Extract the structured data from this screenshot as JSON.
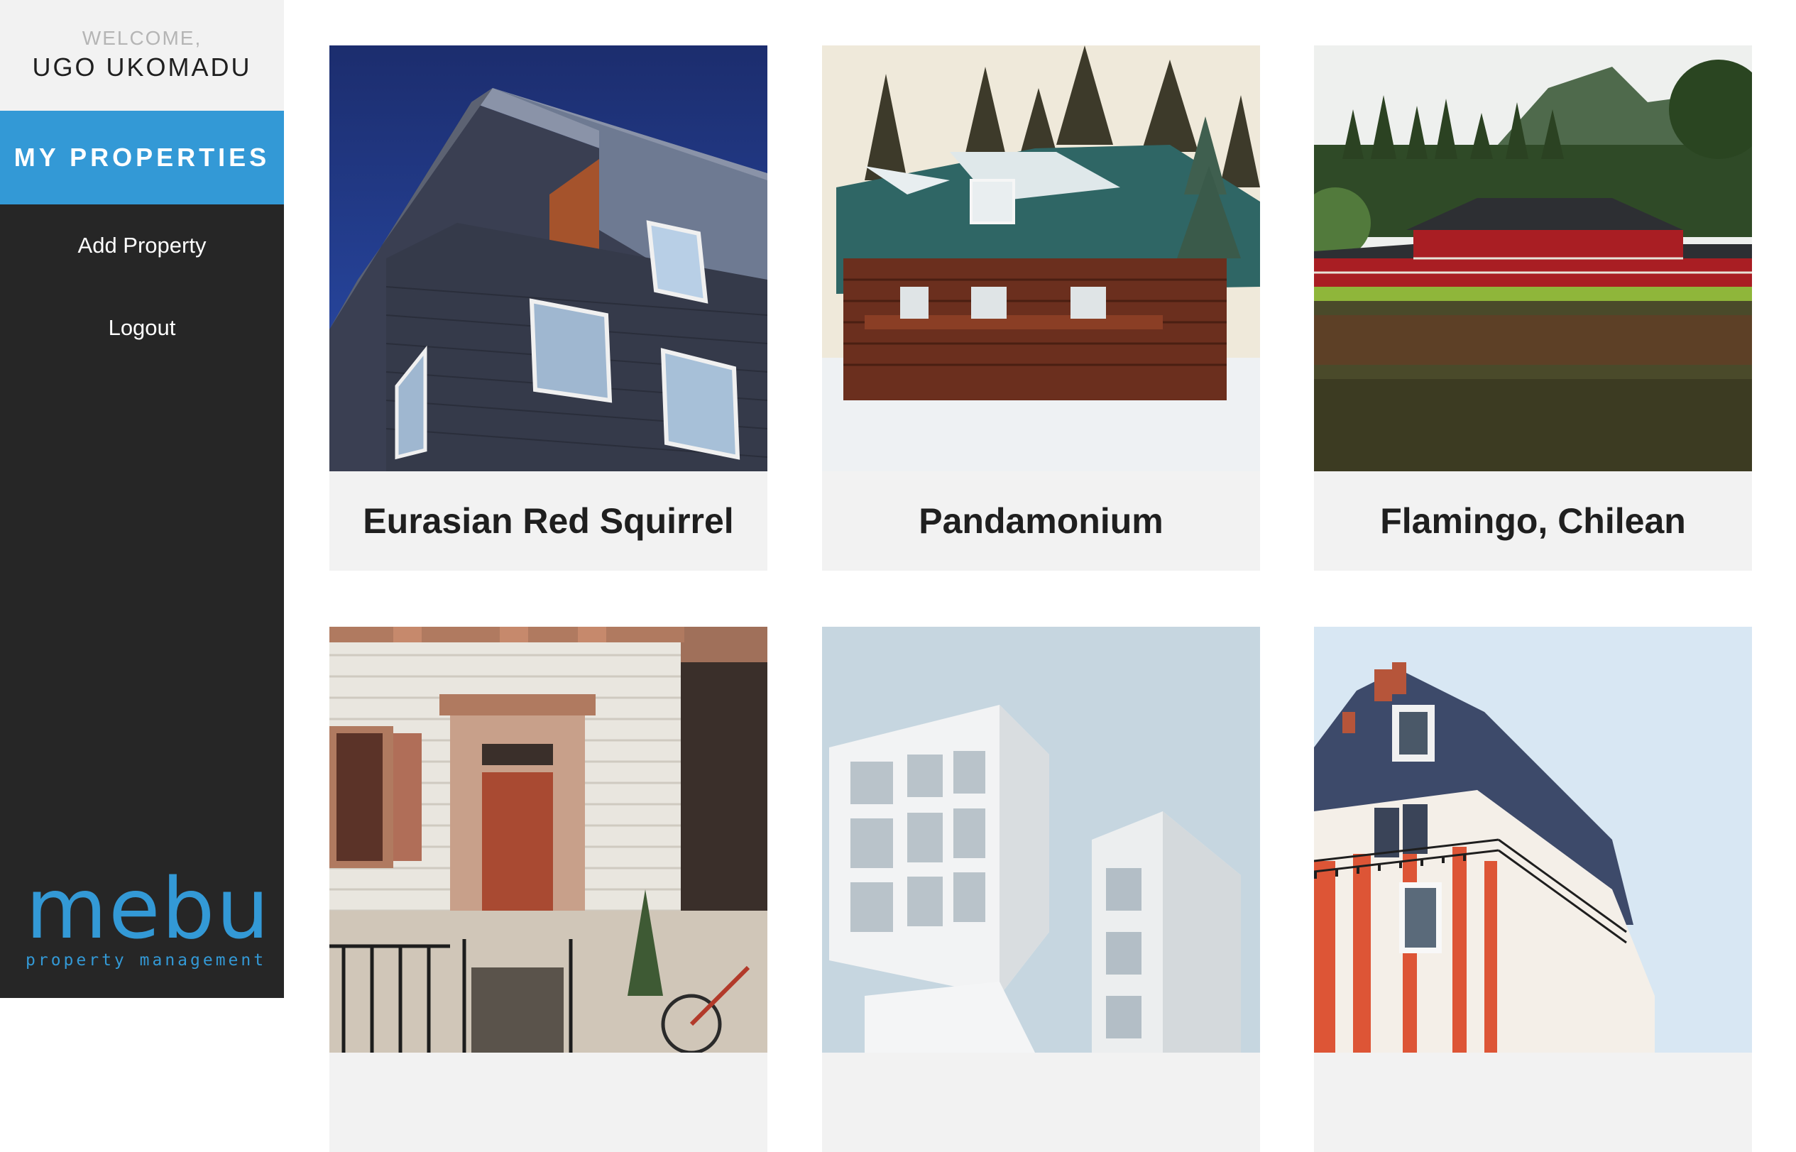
{
  "sidebar": {
    "welcome_label": "WELCOME,",
    "user_name": "UGO UKOMADU",
    "nav": {
      "active": "MY PROPERTIES",
      "add_property": "Add Property",
      "logout": "Logout"
    },
    "logo": {
      "word": "mebu",
      "tagline": "property management"
    }
  },
  "properties": [
    {
      "name": "Eurasian Red Squirrel",
      "image": "modern-brick-building-photo"
    },
    {
      "name": "Pandamonium",
      "image": "snowy-log-cabin-photo"
    },
    {
      "name": "Flamingo, Chilean",
      "image": "japanese-temple-photo"
    },
    {
      "name": "",
      "image": "townhouse-door-photo"
    },
    {
      "name": "",
      "image": "white-modern-building-photo"
    },
    {
      "name": "",
      "image": "parisian-building-photo"
    }
  ],
  "colors": {
    "accent": "#3399d6",
    "sidebar_bg": "#262626",
    "panel_bg": "#f2f2f2"
  }
}
